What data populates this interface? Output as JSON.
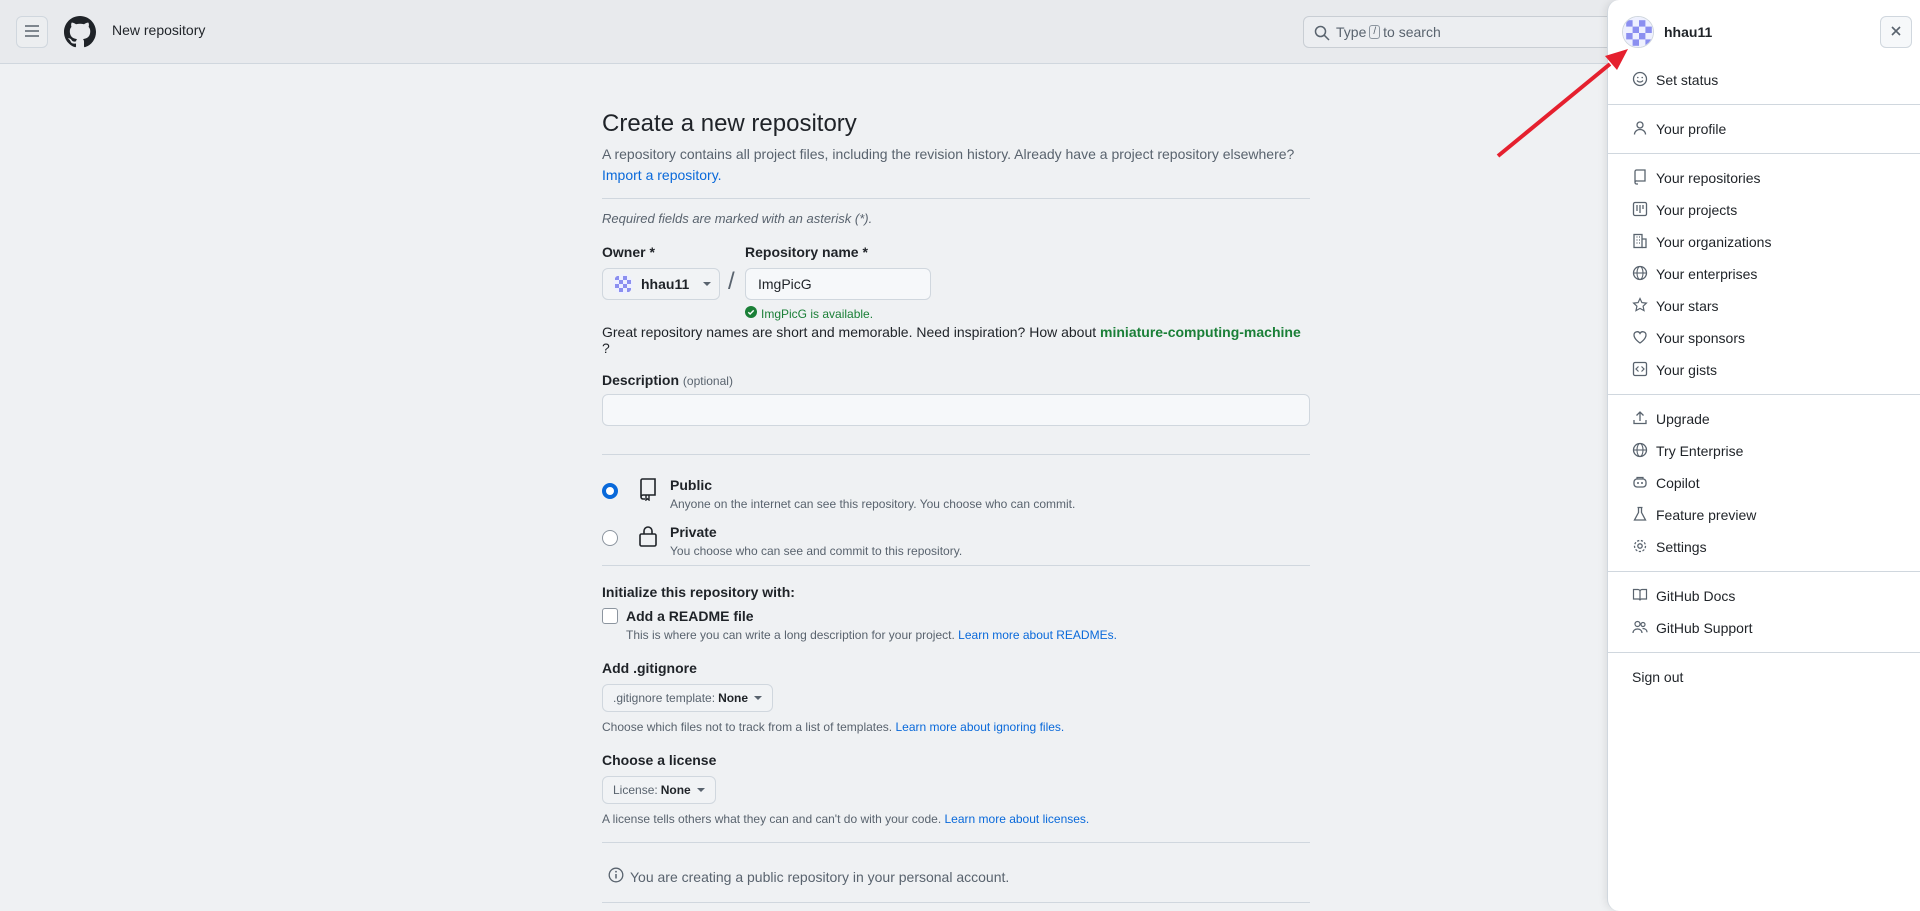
{
  "header": {
    "title": "New repository",
    "search": {
      "prefix": "Type",
      "key": "/",
      "suffix": "to search"
    }
  },
  "form": {
    "title": "Create a new repository",
    "subtitle": "A repository contains all project files, including the revision history. Already have a project repository elsewhere?",
    "import_link": "Import a repository.",
    "required_note": "Required fields are marked with an asterisk (*).",
    "owner_label": "Owner *",
    "owner_value": "hhau11",
    "repo_label": "Repository name *",
    "repo_value": "ImgPicG",
    "available": "ImgPicG is available.",
    "inspire_text": "Great repository names are short and memorable. Need inspiration? How about",
    "inspire_name": "miniature-computing-machine",
    "inspire_end": "?",
    "description_label": "Description",
    "description_optional": "(optional)",
    "visibility": [
      {
        "title": "Public",
        "desc": "Anyone on the internet can see this repository. You choose who can commit.",
        "checked": true
      },
      {
        "title": "Private",
        "desc": "You choose who can see and commit to this repository.",
        "checked": false
      }
    ],
    "init_title": "Initialize this repository with:",
    "readme_label": "Add a README file",
    "readme_desc": "This is where you can write a long description for your project.",
    "readme_link": "Learn more about READMEs.",
    "gitignore_title": "Add .gitignore",
    "gitignore_prefix": ".gitignore template:",
    "gitignore_value": "None",
    "gitignore_help": "Choose which files not to track from a list of templates.",
    "gitignore_link": "Learn more about ignoring files.",
    "license_title": "Choose a license",
    "license_prefix": "License:",
    "license_value": "None",
    "license_help": "A license tells others what they can and can't do with your code.",
    "license_link": "Learn more about licenses.",
    "notice": "You are creating a public repository in your personal account."
  },
  "drawer": {
    "username": "hhau11",
    "items": [
      {
        "label": "Set status",
        "icon": "smiley-icon"
      },
      {
        "label": "Your profile",
        "icon": "person-icon"
      },
      {
        "label": "Your repositories",
        "icon": "repo-icon"
      },
      {
        "label": "Your projects",
        "icon": "project-icon"
      },
      {
        "label": "Your organizations",
        "icon": "organization-icon"
      },
      {
        "label": "Your enterprises",
        "icon": "globe-icon"
      },
      {
        "label": "Your stars",
        "icon": "star-icon"
      },
      {
        "label": "Your sponsors",
        "icon": "heart-icon"
      },
      {
        "label": "Your gists",
        "icon": "code-square-icon"
      },
      {
        "label": "Upgrade",
        "icon": "upload-icon"
      },
      {
        "label": "Try Enterprise",
        "icon": "globe-icon"
      },
      {
        "label": "Copilot",
        "icon": "copilot-icon"
      },
      {
        "label": "Feature preview",
        "icon": "beaker-icon"
      },
      {
        "label": "Settings",
        "icon": "gear-icon"
      },
      {
        "label": "GitHub Docs",
        "icon": "book-icon"
      },
      {
        "label": "GitHub Support",
        "icon": "people-icon"
      },
      {
        "label": "Sign out",
        "icon": ""
      }
    ]
  },
  "colors": {
    "accent": "#0969da",
    "success": "#1a7f37",
    "annotation": "#e5202e"
  }
}
